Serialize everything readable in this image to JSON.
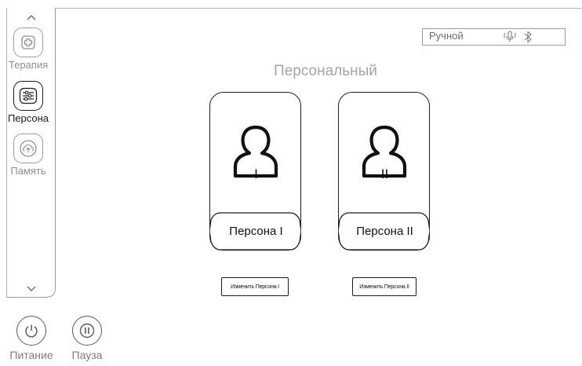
{
  "sidebar": {
    "items": [
      {
        "label": "Терапия",
        "icon": "therapy-plus-icon",
        "active": false
      },
      {
        "label": "Персона",
        "icon": "sliders-icon",
        "active": true
      },
      {
        "label": "Память",
        "icon": "cloud-upload-icon",
        "active": false
      }
    ],
    "scroll_up_icon": "chevron-up-icon",
    "scroll_down_icon": "chevron-down-icon"
  },
  "bottom_controls": {
    "power_label": "Питание",
    "pause_label": "Пауза"
  },
  "status_bar": {
    "mode_label": "Ручной",
    "microphone_icon": "microphone-icon",
    "bluetooth_icon": "bluetooth-icon"
  },
  "page": {
    "title": "Персональный"
  },
  "personas": [
    {
      "numeral": "I",
      "name": "Персона I",
      "edit_label": "Изменить Персона I"
    },
    {
      "numeral": "II",
      "name": "Персона II",
      "edit_label": "Изменить Персона II"
    }
  ],
  "colors": {
    "active": "#1a1a1a",
    "inactive": "#9f9f9f",
    "title": "#a4a4a4"
  }
}
